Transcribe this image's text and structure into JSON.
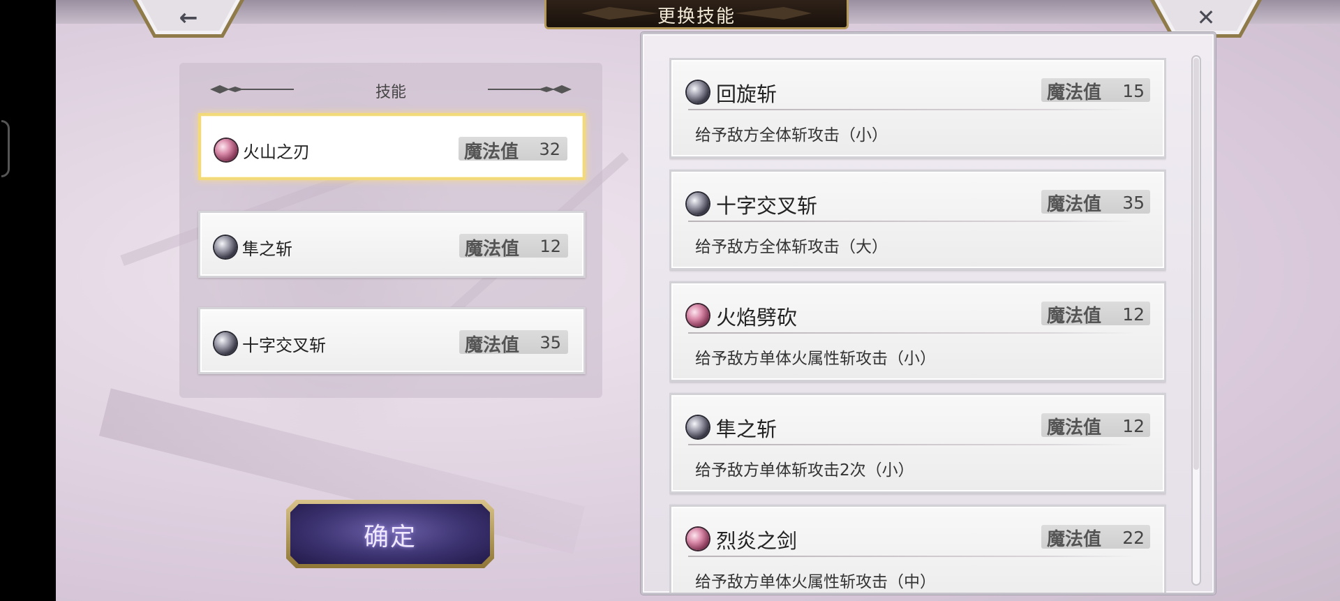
{
  "header": {
    "title": "更换技能",
    "back_glyph": "←",
    "close_glyph": "✕"
  },
  "equipped": {
    "header": "技能",
    "mp_label": "魔法值",
    "items": [
      {
        "name": "火山之刃",
        "mp": "32",
        "element": "fire",
        "selected": true
      },
      {
        "name": "隼之斩",
        "mp": "12",
        "element": "dark",
        "selected": false
      },
      {
        "name": "十字交叉斩",
        "mp": "35",
        "element": "dark",
        "selected": false
      }
    ]
  },
  "confirm": {
    "label": "确定"
  },
  "skill_list": {
    "mp_label": "魔法值",
    "items": [
      {
        "name": "回旋斩",
        "mp": "15",
        "element": "dark",
        "desc": "给予敌方全体斩攻击（小）"
      },
      {
        "name": "十字交叉斩",
        "mp": "35",
        "element": "dark",
        "desc": "给予敌方全体斩攻击（大）"
      },
      {
        "name": "火焰劈砍",
        "mp": "12",
        "element": "fire",
        "desc": "给予敌方单体火属性斩攻击（小）"
      },
      {
        "name": "隼之斩",
        "mp": "12",
        "element": "dark",
        "desc": "给予敌方单体斩攻击2次（小）"
      },
      {
        "name": "烈炎之剑",
        "mp": "22",
        "element": "fire",
        "desc": "给予敌方单体火属性斩攻击（中）"
      }
    ]
  },
  "colors": {
    "selected_border": "#f2d97a",
    "banner_gold": "#b59a5a",
    "confirm_purple": "#3b3270",
    "fire_orb": "#d98aa8",
    "dark_orb": "#3a3a48"
  },
  "icons": {
    "back": "back-arrow-icon",
    "close": "close-icon",
    "fire_element": "fire-element-orb-icon",
    "dark_element": "dark-element-orb-icon",
    "header_ornament": "ornament-divider-icon"
  }
}
